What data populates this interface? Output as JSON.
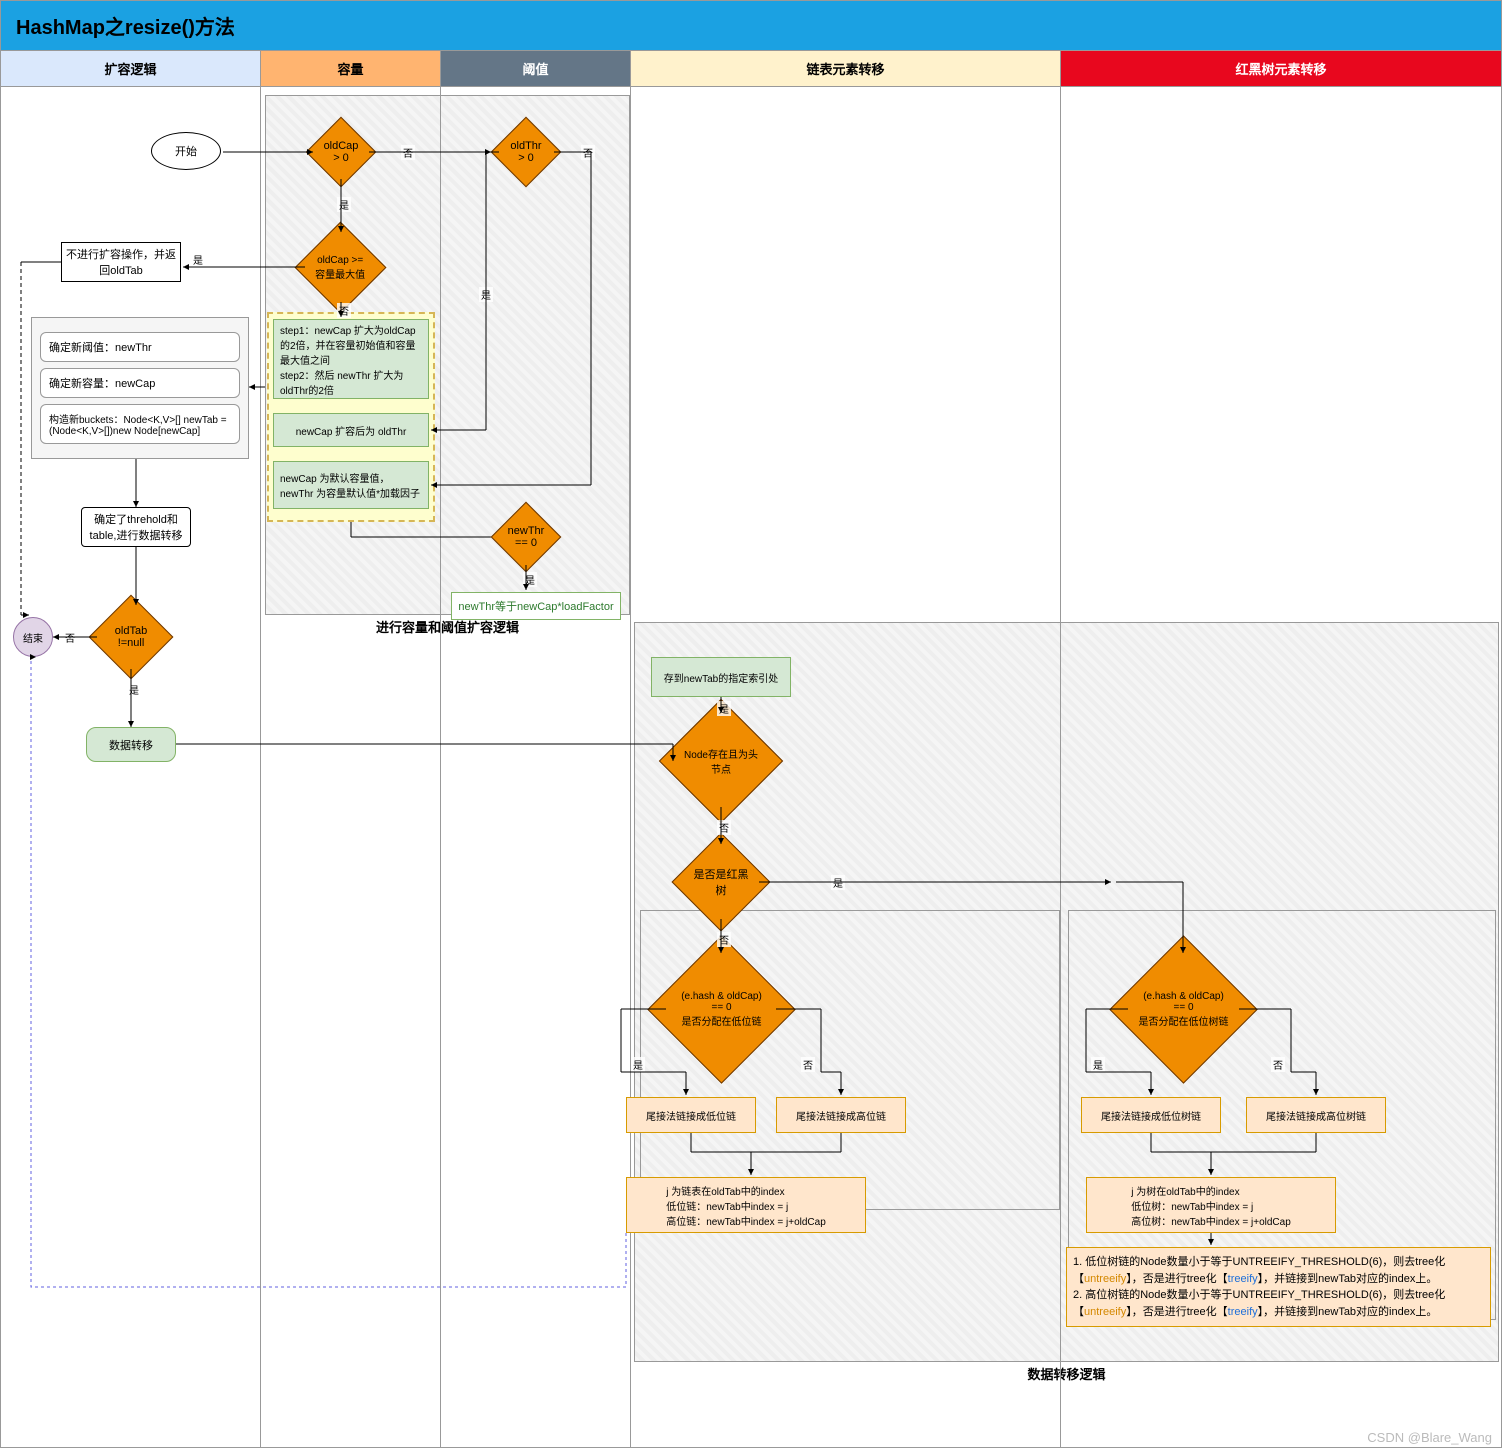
{
  "title": "HashMap之resize()方法",
  "lanes": {
    "l1": "扩容逻辑",
    "l2": "容量",
    "l3": "阈值",
    "l4": "链表元素转移",
    "l5": "红黑树元素转移"
  },
  "nodes": {
    "start": "开始",
    "end": "结束",
    "oldCapGt0": "oldCap > 0",
    "oldThrGt0": "oldThr > 0",
    "oldCapGeMax": "oldCap >=容量最大值",
    "noResize": "不进行扩容操作，并返回oldTab",
    "step12": "step1：newCap 扩大为oldCap的2倍，并在容量初始值和容量最大值之间\nstep2：然后 newThr 扩大为oldThr的2倍",
    "newCapFromThr": "newCap 扩容后为 oldThr",
    "defaultCap": "newCap 为默认容量值，newThr 为容量默认值*加载因子",
    "newThr0": "newThr == 0",
    "newThrCalc": "newThr等于newCap*loadFactor",
    "box_newThr": "确定新阈值：newThr",
    "box_newCap": "确定新容量：newCap",
    "box_buckets": "构造新buckets：Node<K,V>[] newTab = (Node<K,V>[])new Node[newCap]",
    "afterBox": "确定了threhold和table,进行数据转移",
    "oldTabNotNull": "oldTab !=null",
    "dataMove": "数据转移",
    "storeNewTab": "存到newTab的指定索引处",
    "nodeHead": "Node存在且为头节点",
    "isRBT": "是否是红黑树",
    "hashLow_list": "(e.hash & oldCap) == 0\n是否分配在低位链",
    "lowChain": "尾接法链接成低位链",
    "highChain": "尾接法链接成高位链",
    "listIndex": "j 为链表在oldTab中的index\n低位链：newTab中index = j\n高位链：newTab中index = j+oldCap",
    "hashLow_tree": "(e.hash & oldCap) == 0\n是否分配在低位树链",
    "lowTree": "尾接法链接成低位树链",
    "highTree": "尾接法链接成高位树链",
    "treeIndex": "j 为树在oldTab中的index\n低位树：newTab中index = j\n高位树：newTab中index = j+oldCap",
    "treeifyNote_1a": "1. 低位树链的Node数量小于等于UNTREEIFY_THRESHOLD(6)，则去tree化【",
    "treeifyNote_1b": "】，否是进行tree化【",
    "treeifyNote_1c": "】，并链接到newTab对应的index上。",
    "treeifyNote_2a": "2. 高位树链的Node数量小于等于UNTREEIFY_THRESHOLD(6)，则去tree化【",
    "treeifyNote_2b": "】，否是进行tree化【",
    "treeifyNote_2c": "】，并链接到newTab对应的index上。",
    "untreeify": "untreeify",
    "treeify": "treeify"
  },
  "labels": {
    "yes": "是",
    "no": "否"
  },
  "groups": {
    "capThr": "进行容量和阈值扩容逻辑",
    "dataLogic": "数据转移逻辑"
  },
  "credit": "CSDN @Blare_Wang"
}
